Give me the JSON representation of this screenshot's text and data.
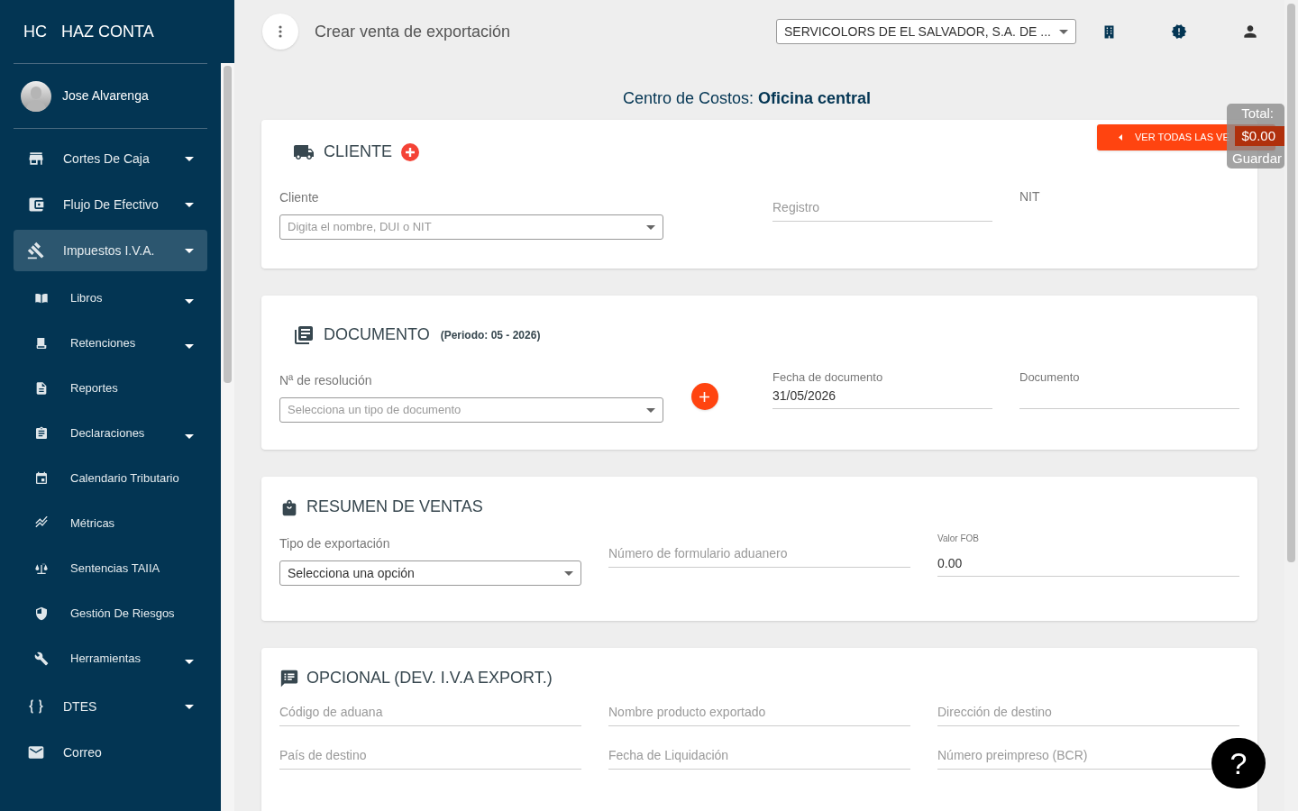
{
  "brand": {
    "initials": "HC",
    "name": "HAZ CONTA"
  },
  "user": {
    "name": "Jose Alvarenga"
  },
  "nav": [
    {
      "label": "Cortes De Caja",
      "expandable": true,
      "selected": false
    },
    {
      "label": "Flujo De Efectivo",
      "expandable": true,
      "selected": false
    },
    {
      "label": "Impuestos I.V.A.",
      "expandable": true,
      "selected": true,
      "children": [
        {
          "label": "Libros",
          "expandable": true
        },
        {
          "label": "Retenciones",
          "expandable": true
        },
        {
          "label": "Reportes",
          "expandable": false
        },
        {
          "label": "Declaraciones",
          "expandable": true
        },
        {
          "label": "Calendario Tributario",
          "expandable": false
        },
        {
          "label": "Métricas",
          "expandable": false
        },
        {
          "label": "Sentencias TAIIA",
          "expandable": false
        },
        {
          "label": "Gestión De Riesgos",
          "expandable": false
        },
        {
          "label": "Herramientas",
          "expandable": true
        }
      ]
    },
    {
      "label": "DTES",
      "expandable": true,
      "selected": false
    },
    {
      "label": "Correo",
      "expandable": false,
      "selected": false
    }
  ],
  "header": {
    "title": "Crear venta de exportación",
    "company": "SERVICOLORS DE EL SALVADOR, S.A. DE ..."
  },
  "cost_center": {
    "label": "Centro de Costos:",
    "value": "Oficina central"
  },
  "view_all_button": "VER TODAS LAS VE",
  "total_panel": {
    "label": "Total:",
    "amount": "$0.00",
    "action": "Guardar"
  },
  "sections": [
    {
      "title": "CLIENTE",
      "has_add": true,
      "fields": [
        {
          "kind": "select",
          "label": "Cliente",
          "placeholder": "Digita el nombre, DUI o NIT"
        },
        {
          "kind": "line",
          "label": "Registro",
          "floated": false
        },
        {
          "kind": "text",
          "label": "NIT"
        }
      ]
    },
    {
      "title": "DOCUMENTO",
      "note": "(Periodo: 05 - 2026)",
      "has_add": false,
      "fields": [
        {
          "kind": "select",
          "label": "Nª de resolución",
          "placeholder": "Selecciona un tipo de documento"
        },
        {
          "kind": "add"
        },
        {
          "kind": "line",
          "label": "Fecha de documento",
          "floated": true,
          "value": "31/05/2026"
        },
        {
          "kind": "line",
          "label": "Documento",
          "floated": true
        }
      ]
    },
    {
      "title": "RESUMEN DE VENTAS",
      "has_add": false,
      "fields": [
        {
          "kind": "select",
          "label": "Tipo de exportación",
          "value": "Selecciona una opción"
        },
        {
          "kind": "line",
          "label": "Número de formulario aduanero",
          "floated": false
        },
        {
          "kind": "line",
          "label": "Valor FOB",
          "floated": true,
          "value": "0.00"
        }
      ]
    },
    {
      "title": "OPCIONAL (DEV. I.V.A EXPORT.)",
      "has_add": false,
      "fields": [
        {
          "kind": "line",
          "label": "Código de aduana",
          "floated": false
        },
        {
          "kind": "line",
          "label": "Nombre producto exportado",
          "floated": false
        },
        {
          "kind": "line",
          "label": "Dirección de destino",
          "floated": false
        },
        {
          "kind": "line",
          "label": "País de destino",
          "floated": false
        },
        {
          "kind": "line",
          "label": "Fecha de Liquidación",
          "floated": false
        },
        {
          "kind": "line",
          "label": "Número preimpreso (BCR)",
          "floated": false
        }
      ]
    }
  ],
  "help_button": "?"
}
